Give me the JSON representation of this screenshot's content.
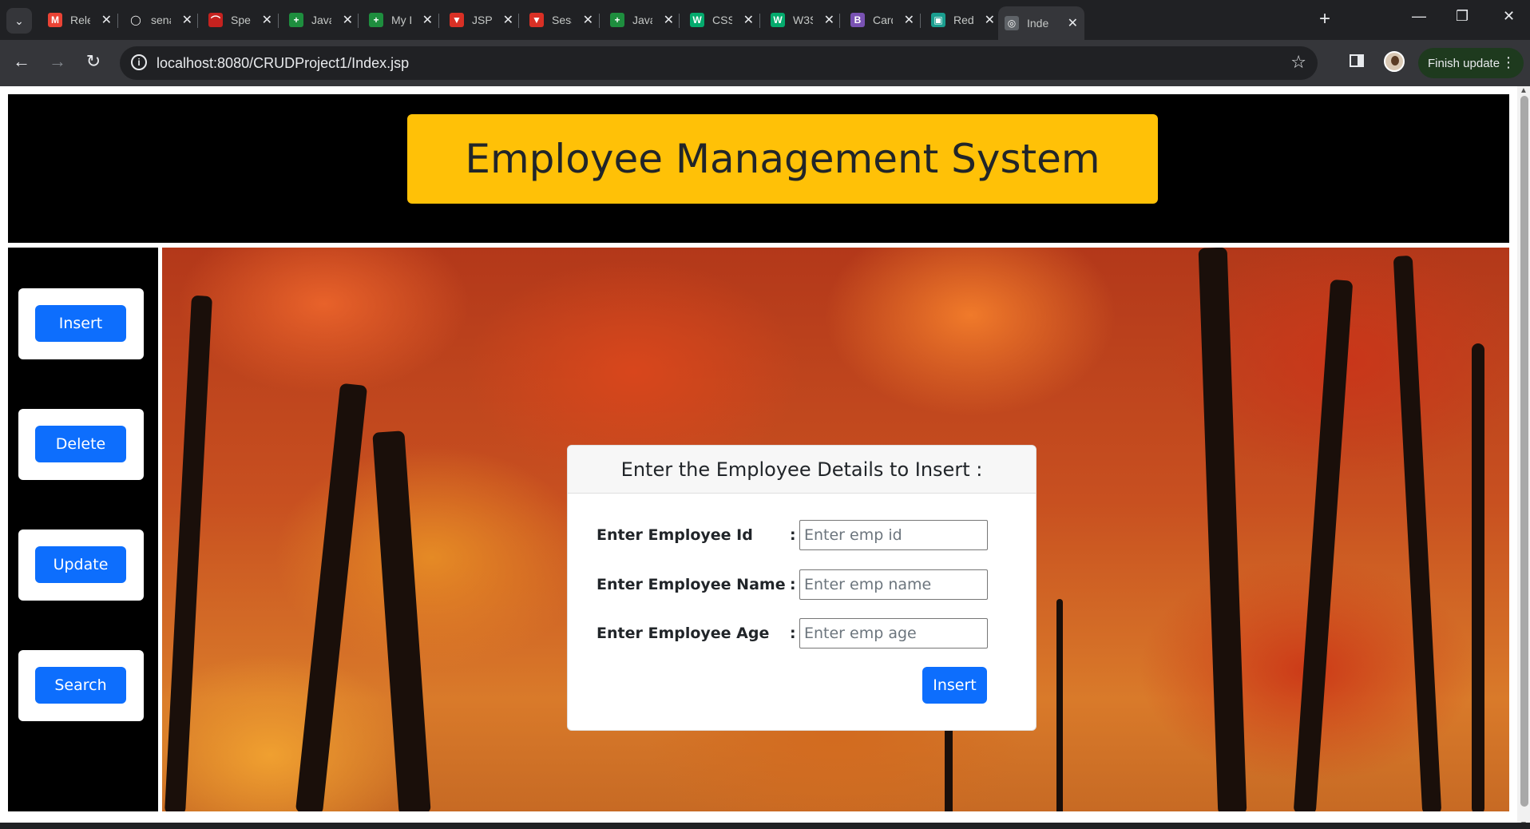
{
  "browser": {
    "tabs": [
      {
        "title": "Relev",
        "favicon": "gmail-icon",
        "color": "#ea4335",
        "glyph": "M"
      },
      {
        "title": "senat",
        "favicon": "github-icon",
        "color": "#202124",
        "glyph": "◯"
      },
      {
        "title": "Sperı",
        "favicon": "site-icon",
        "color": "#c5221f",
        "glyph": "⌒"
      },
      {
        "title": "Java",
        "favicon": "sheets-icon",
        "color": "#1e8e3e",
        "glyph": "+"
      },
      {
        "title": "My D",
        "favicon": "sheets-icon",
        "color": "#1e8e3e",
        "glyph": "+"
      },
      {
        "title": "JSP E",
        "favicon": "vivaldi-icon",
        "color": "#d93025",
        "glyph": "▼"
      },
      {
        "title": "Sessi",
        "favicon": "vivaldi-icon",
        "color": "#d93025",
        "glyph": "▼"
      },
      {
        "title": "Java",
        "favicon": "sheets-icon",
        "color": "#1e8e3e",
        "glyph": "+"
      },
      {
        "title": "CSS (",
        "favicon": "w3schools-icon",
        "color": "#04aa6d",
        "glyph": "W"
      },
      {
        "title": "W3S",
        "favicon": "w3schools-icon",
        "color": "#04aa6d",
        "glyph": "W"
      },
      {
        "title": "Card",
        "favicon": "bootstrap-icon",
        "color": "#7952b3",
        "glyph": "B"
      },
      {
        "title": "Red l",
        "favicon": "site-icon",
        "color": "#1a9e8f",
        "glyph": "▣"
      },
      {
        "title": "Inde",
        "favicon": "globe-icon",
        "color": "#5f6368",
        "glyph": "◎"
      }
    ],
    "url": "localhost:8080/CRUDProject1/Index.jsp",
    "update_label": "Finish update"
  },
  "page": {
    "title": "Employee Management System",
    "menu": [
      {
        "label": "Insert"
      },
      {
        "label": "Delete"
      },
      {
        "label": "Update"
      },
      {
        "label": "Search"
      }
    ],
    "form": {
      "heading": "Enter the Employee Details to Insert :",
      "fields": [
        {
          "label": "Enter Employee Id",
          "colon": ":",
          "placeholder": "Enter emp id",
          "value": ""
        },
        {
          "label": "Enter Employee Name",
          "colon": ":",
          "placeholder": "Enter emp name",
          "value": ""
        },
        {
          "label": "Enter Employee Age",
          "colon": ":",
          "placeholder": "Enter emp age",
          "value": ""
        }
      ],
      "submit_label": "Insert"
    }
  },
  "colors": {
    "title_bg": "#ffc107",
    "button_bg": "#0d6efd",
    "band_bg": "#000000"
  }
}
